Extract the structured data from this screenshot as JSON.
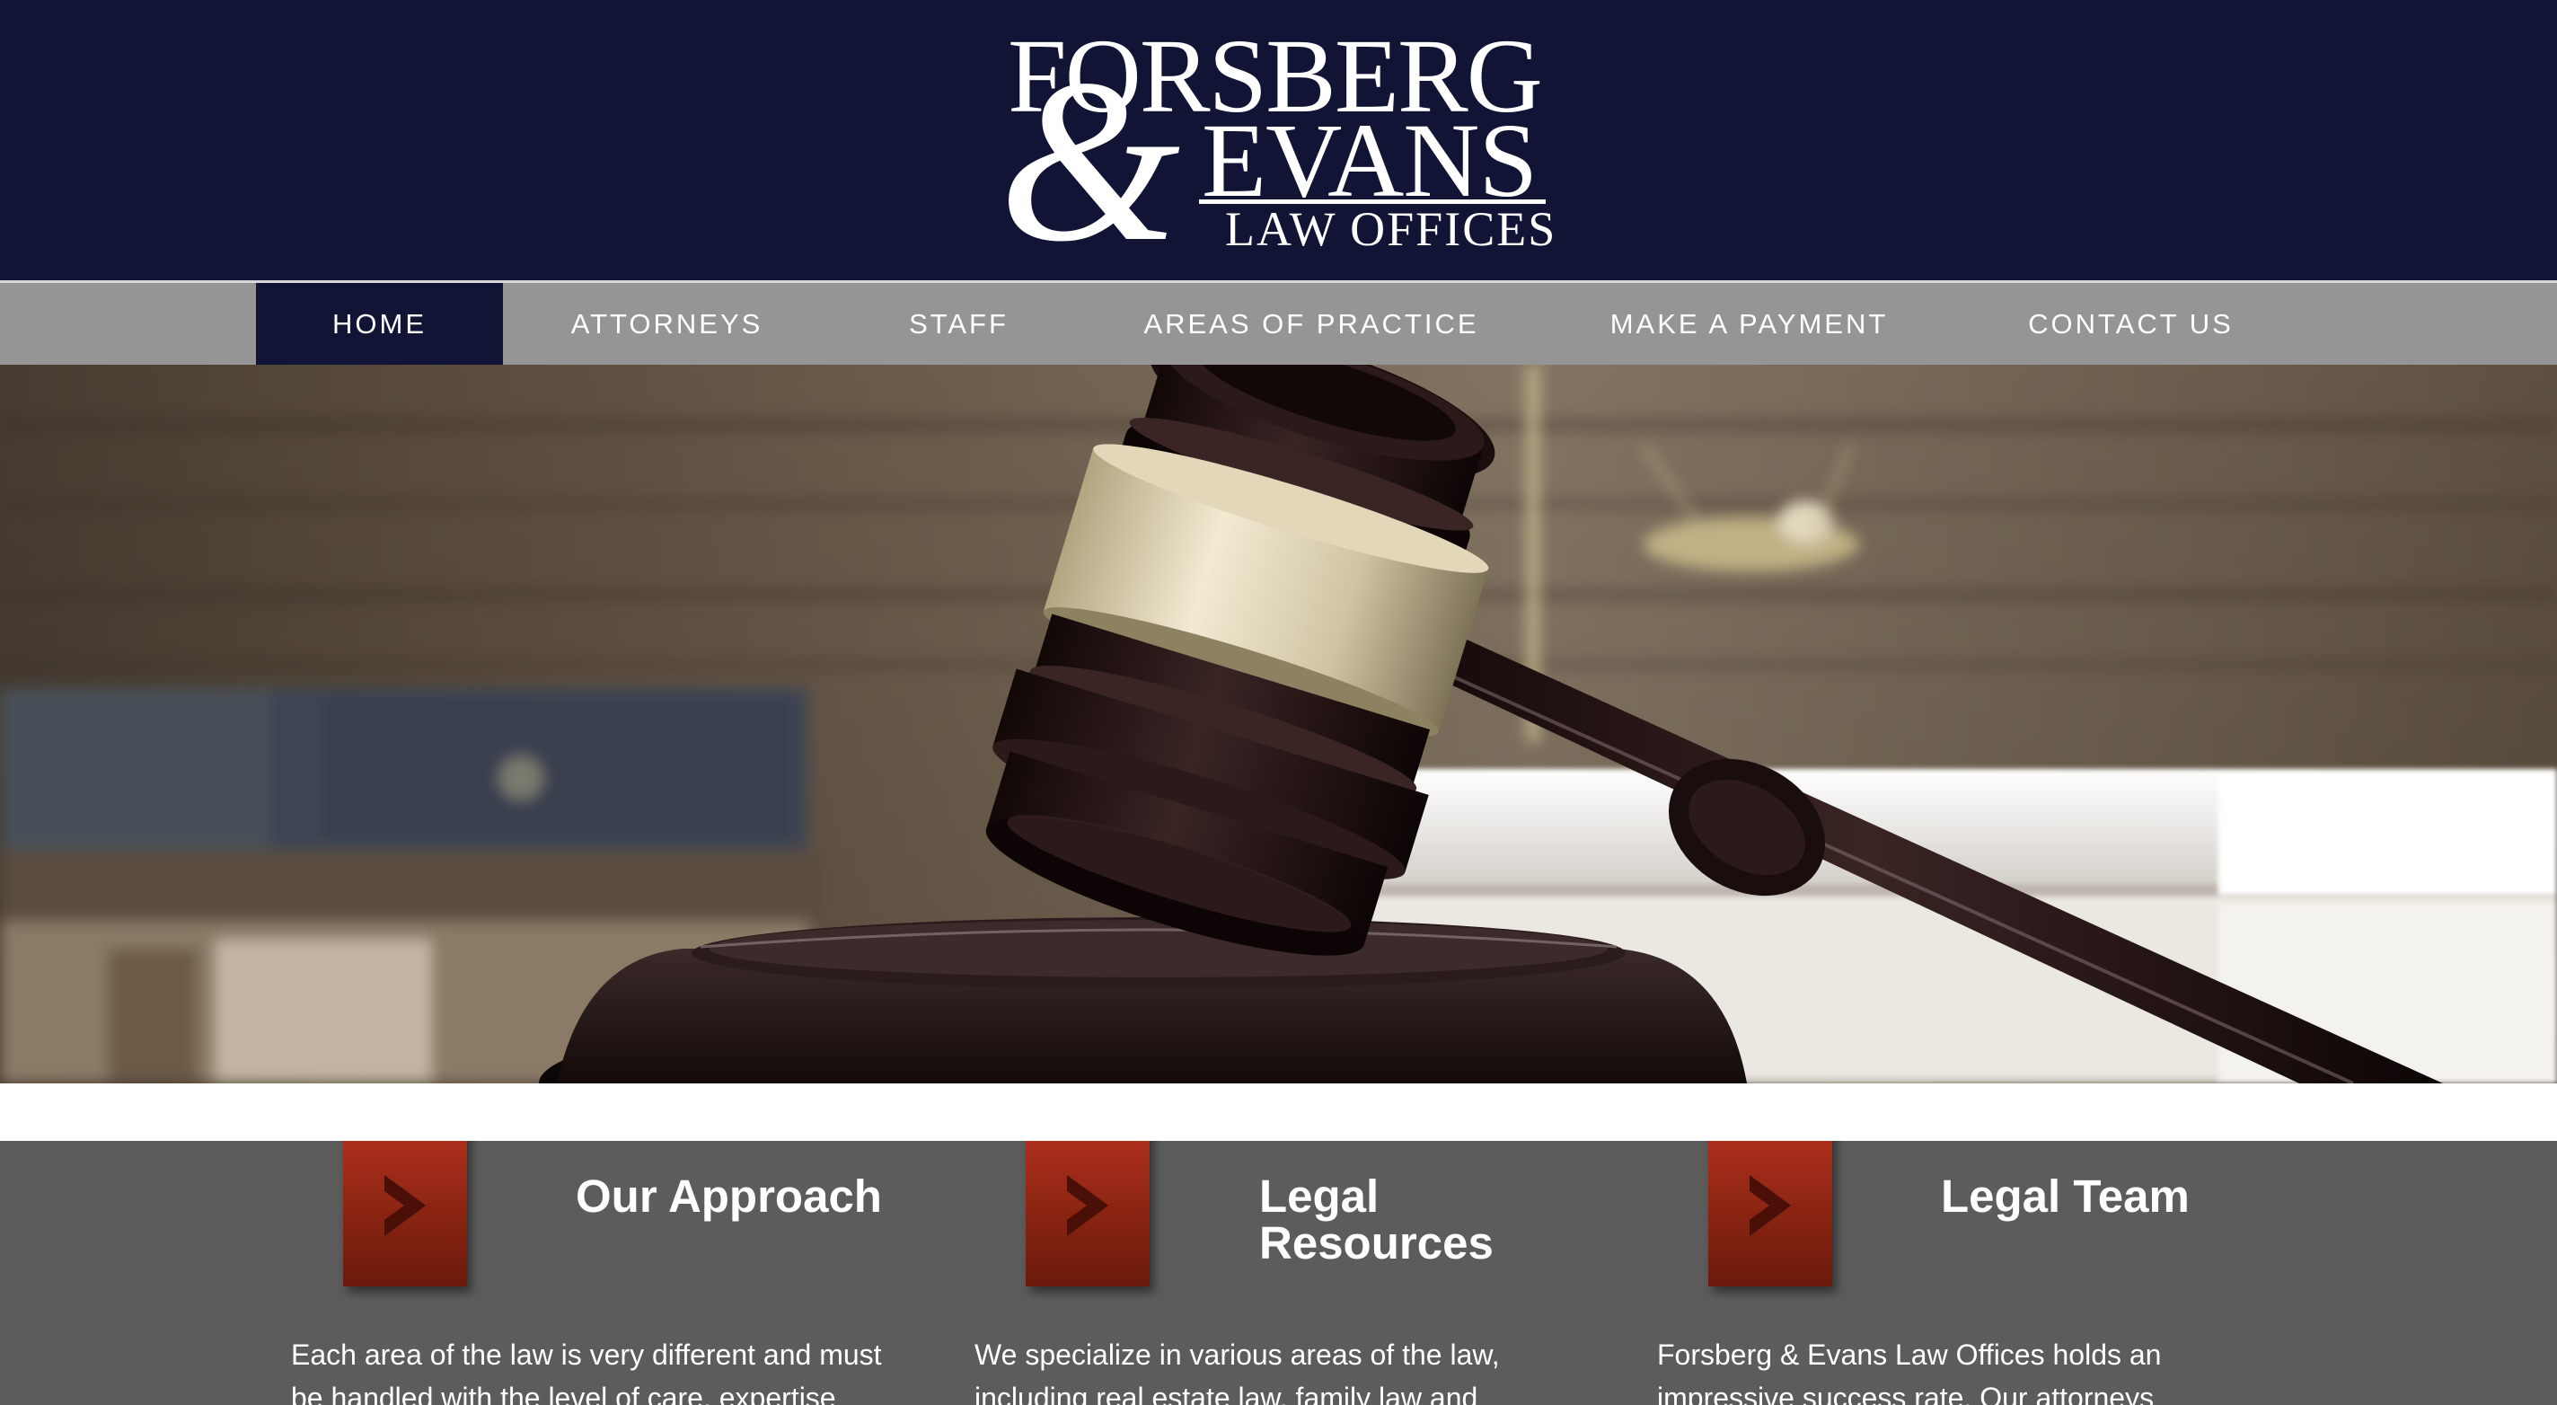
{
  "logo": {
    "line1": "FORSBERG",
    "ampersand": "&",
    "line2": "EVANS",
    "line3": "LAW OFFICES"
  },
  "nav": {
    "items": [
      {
        "label": "HOME",
        "active": true
      },
      {
        "label": "ATTORNEYS"
      },
      {
        "label": "STAFF"
      },
      {
        "label": "AREAS OF PRACTICE"
      },
      {
        "label": "MAKE A PAYMENT"
      },
      {
        "label": "CONTACT US"
      }
    ]
  },
  "hero": {
    "image": "gavel-on-sound-block-with-law-books-and-scales"
  },
  "features": [
    {
      "title": "Our Approach",
      "text": "Each area of the law is very different and must be handled with the level of care, expertise",
      "icon": "chevron-right-icon"
    },
    {
      "title": "Legal Resources",
      "title_line1": "Legal",
      "title_line2": "Resources",
      "text": "We specialize in various areas of the law, including real estate law, family law and",
      "icon": "chevron-right-icon"
    },
    {
      "title": "Legal Team",
      "text": "Forsberg & Evans Law Offices holds an impressive success rate. Our attorneys",
      "icon": "chevron-right-icon"
    }
  ],
  "colors": {
    "header_bg": "#121436",
    "nav_bg": "#959595",
    "nav_active_bg": "#121436",
    "features_bg": "#5c5c5c",
    "accent_red": "#9a2a14"
  }
}
